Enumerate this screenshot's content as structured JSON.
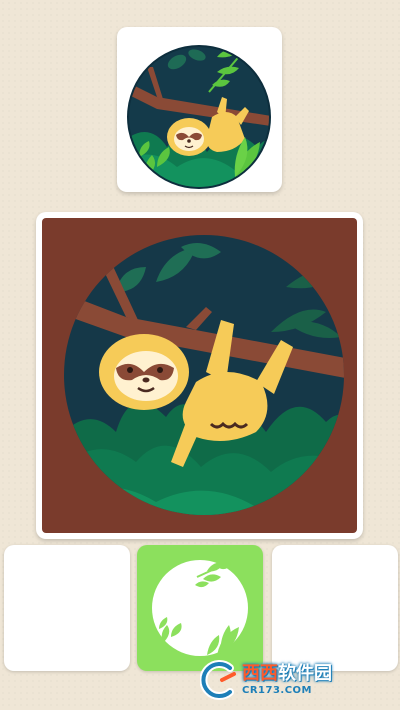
{
  "target_card": {
    "icon": "sloth-on-branch-image"
  },
  "main_card": {
    "icon": "sloth-on-branch-large-image"
  },
  "slots": [
    {
      "state": "empty"
    },
    {
      "state": "filled",
      "piece": "leaf-circle-frame-piece"
    },
    {
      "state": "empty"
    }
  ],
  "colors": {
    "background": "#efe6d6",
    "frame_brown": "#7a3b2c",
    "night_navy": "#153848",
    "jungle_green": "#0f7a50",
    "leaf_green": "#5bc53f",
    "sloth_yellow": "#f6cb58",
    "piece_green": "#8ce05d"
  },
  "watermark": {
    "name_part1": "西西",
    "name_part2": "软件园",
    "url": "CR173.COM"
  }
}
